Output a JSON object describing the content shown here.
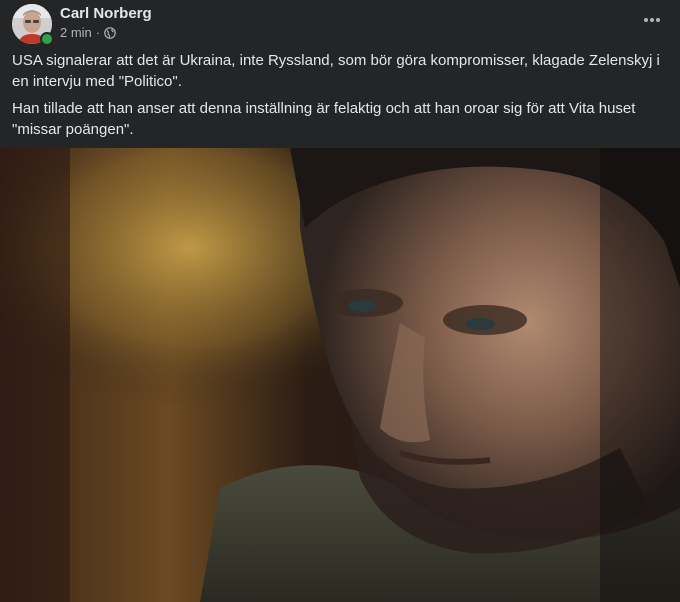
{
  "post": {
    "author": "Carl Norberg",
    "time": "2 min",
    "separator": "·",
    "privacy_icon": "globe-icon",
    "more_icon": "more-options-icon",
    "paragraphs": [
      "USA signalerar att det är Ukraina, inte Ryssland, som bör göra kompromisser, klagade Zelenskyj i en intervju med \"Politico\".",
      "Han tillade att han anser att denna inställning är felaktig och att han oroar sig för att Vita huset \"missar poängen\"."
    ]
  },
  "colors": {
    "background": "#242526",
    "primary_text": "#e4e6eb",
    "secondary_text": "#b0b3b8",
    "online_status": "#31a24c"
  }
}
